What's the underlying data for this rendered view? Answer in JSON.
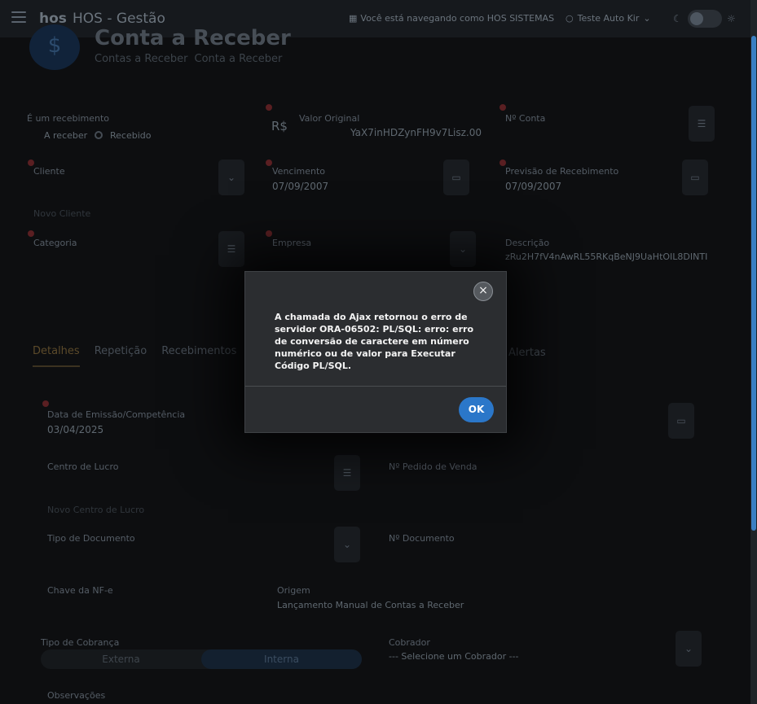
{
  "topbar": {
    "logo": "hos",
    "app_title": "HOS - Gestão",
    "browsing_as": "Você está navegando como HOS SISTEMAS",
    "user_name": "Teste Auto Kir"
  },
  "header": {
    "icon_glyph": "$",
    "title": "Conta a Receber",
    "breadcrumb": [
      "Contas a Receber",
      "Conta a Receber"
    ]
  },
  "form": {
    "recebimento_label": "É um recebimento",
    "radio_options": [
      "A receber",
      "Recebido"
    ],
    "valor_original_label": "Valor Original",
    "valor_original_prefix": "R$",
    "valor_original_value": "YaX7inHDZynFH9v7Lisz.00",
    "no_conta_label": "Nº Conta",
    "cliente_label": "Cliente",
    "vencimento_label": "Vencimento",
    "vencimento_value": "07/09/2007",
    "previsao_label": "Previsão de Recebimento",
    "previsao_value": "07/09/2007",
    "novo_cliente_link": "Novo Cliente",
    "categoria_label": "Categoria",
    "empresa_label": "Empresa",
    "descricao_label": "Descrição",
    "descricao_value": "zRu2H7fV4nAwRL55RKqBeNJ9UaHtOIL8DINTI"
  },
  "tabs": [
    "Detalhes",
    "Repetição",
    "Recebimentos",
    "",
    "Alertas"
  ],
  "details": {
    "data_emissao_label": "Data de Emissão/Competência",
    "data_emissao_value": "03/04/2025",
    "centro_lucro_label": "Centro de Lucro",
    "pedido_venda_label": "Nº Pedido de Venda",
    "novo_centro_link": "Novo Centro de Lucro",
    "tipo_documento_label": "Tipo de Documento",
    "num_documento_label": "Nº Documento",
    "chave_nfe_label": "Chave da NF-e",
    "origem_label": "Origem",
    "origem_value": "Lançamento Manual de Contas a Receber",
    "tipo_cobranca_label": "Tipo de Cobrança",
    "tipo_cobranca_options": [
      "Externa",
      "Interna"
    ],
    "cobrador_label": "Cobrador",
    "cobrador_value": "--- Selecione um Cobrador ---",
    "observacoes_label": "Observações"
  },
  "dialog": {
    "message": "A chamada do Ajax retornou o erro de servidor ORA-06502: PL/SQL: erro: erro de conversão de caractere em número numérico ou de valor para Executar Código PL/SQL.",
    "ok_label": "OK",
    "close_glyph": "×"
  },
  "colors": {
    "accent": "#2b77c9",
    "dialog_bg": "#2b2d30",
    "page_bg": "#0d0e10"
  }
}
